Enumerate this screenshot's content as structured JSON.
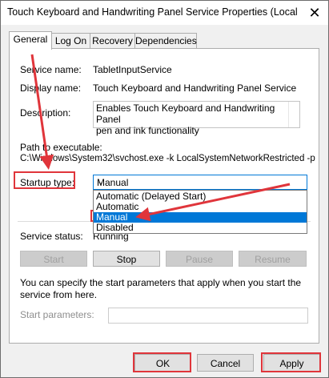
{
  "window": {
    "title": "Touch Keyboard and Handwriting Panel Service Properties (Local C...",
    "close_glyph": "✕"
  },
  "tabs": [
    {
      "label": "General"
    },
    {
      "label": "Log On"
    },
    {
      "label": "Recovery"
    },
    {
      "label": "Dependencies"
    }
  ],
  "general": {
    "service_name_label": "Service name:",
    "service_name_value": "TabletInputService",
    "display_name_label": "Display name:",
    "display_name_value": "Touch Keyboard and Handwriting Panel Service",
    "description_label": "Description:",
    "description_line1": "Enables Touch Keyboard and Handwriting Panel",
    "description_line2": "pen and ink functionality",
    "path_label": "Path to executable:",
    "path_value": "C:\\Windows\\System32\\svchost.exe -k LocalSystemNetworkRestricted -p",
    "startup_type_label": "Startup type:",
    "startup_type_selected": "Manual",
    "startup_options": [
      "Automatic (Delayed Start)",
      "Automatic",
      "Manual",
      "Disabled"
    ],
    "service_status_label": "Service status:",
    "service_status_value": "Running",
    "buttons": {
      "start": "Start",
      "stop": "Stop",
      "pause": "Pause",
      "resume": "Resume"
    },
    "params_hint": "You can specify the start parameters that apply when you start the service from here.",
    "start_params_label": "Start parameters:"
  },
  "footer": {
    "ok": "OK",
    "cancel": "Cancel",
    "apply": "Apply"
  },
  "colors": {
    "annotation_red": "#e0353b",
    "selection_blue": "#0078d7"
  }
}
